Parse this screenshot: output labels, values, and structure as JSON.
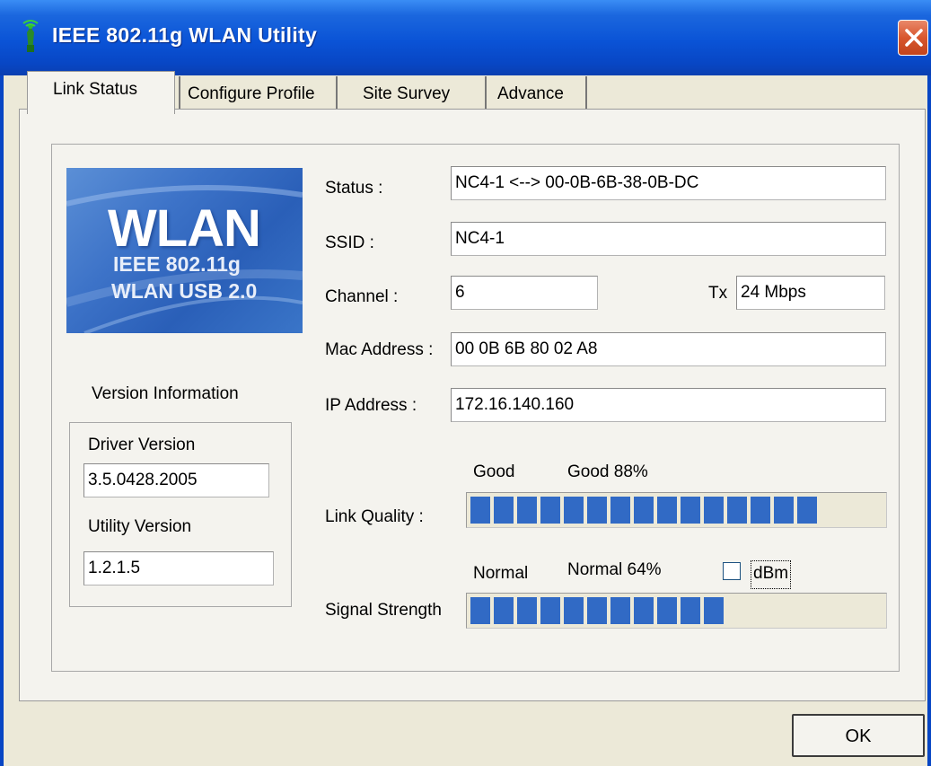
{
  "window": {
    "title": "IEEE 802.11g WLAN Utility"
  },
  "tabs": [
    {
      "label": "Link Status",
      "active": true
    },
    {
      "label": "Configure Profile",
      "active": false
    },
    {
      "label": "Site Survey",
      "active": false
    },
    {
      "label": "Advance",
      "active": false
    }
  ],
  "logo": {
    "big": "WLAN",
    "line2": "IEEE 802.11g",
    "line3": "WLAN USB 2.0"
  },
  "version": {
    "heading": "Version Information",
    "driver_label": "Driver Version",
    "driver_value": "3.5.0428.2005",
    "utility_label": "Utility Version",
    "utility_value": "1.2.1.5"
  },
  "status": {
    "status_label": "Status :",
    "status_value": "NC4-1 <--> 00-0B-6B-38-0B-DC",
    "ssid_label": "SSID :",
    "ssid_value": "NC4-1",
    "channel_label": "Channel :",
    "channel_value": "6",
    "tx_label": "Tx",
    "tx_value": "24 Mbps",
    "mac_label": "Mac Address :",
    "mac_value": "00 0B 6B 80 02 A8",
    "ip_label": "IP Address :",
    "ip_value": "172.16.140.160"
  },
  "link_quality": {
    "label": "Link Quality :",
    "word": "Good",
    "text": "Good 88%",
    "percent": 88
  },
  "signal_strength": {
    "label": "Signal Strength",
    "word": "Normal",
    "text": "Normal 64%",
    "percent": 64,
    "dbm_label": "dBm",
    "dbm_checked": false
  },
  "buttons": {
    "ok": "OK"
  },
  "colors": {
    "meter_fill": "#316ac5",
    "titlebar": "#0a53d6",
    "close": "#d8562d"
  }
}
